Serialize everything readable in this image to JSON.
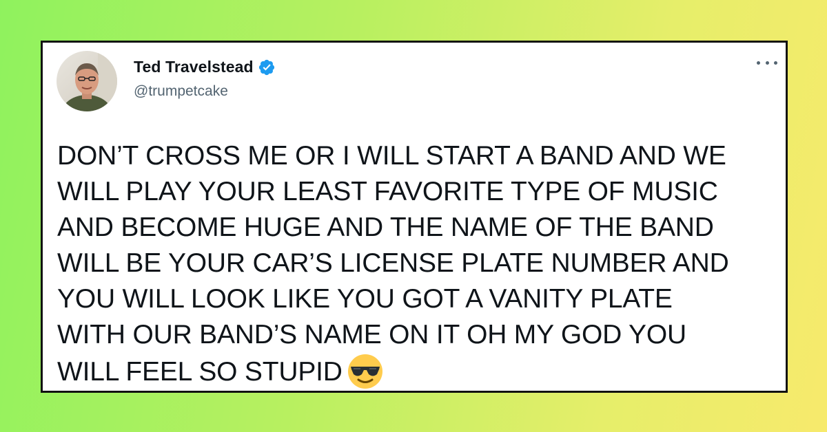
{
  "tweet": {
    "author": {
      "display_name": "Ted Travelstead",
      "handle": "@trumpetcake",
      "verified": true
    },
    "text": "DON’T CROSS ME OR I WILL START A BAND AND WE\nWILL PLAY YOUR LEAST FAVORITE TYPE OF MUSIC\nAND BECOME HUGE AND THE NAME OF THE BAND\nWILL BE YOUR CAR’S LICENSE PLATE NUMBER AND\nYOU WILL LOOK LIKE YOU GOT A VANITY PLATE\nWITH OUR BAND’S NAME ON IT OH MY GOD YOU\nWILL FEEL SO STUPID",
    "emoji": "smiling-face-with-sunglasses",
    "more_icon": "ellipsis-icon"
  },
  "colors": {
    "verified_badge": "#1d9bf0",
    "text_primary": "#0f1419",
    "text_secondary": "#536471",
    "card_border": "#111111",
    "background_start": "#8ff25e",
    "background_end": "#f7ea6c"
  }
}
